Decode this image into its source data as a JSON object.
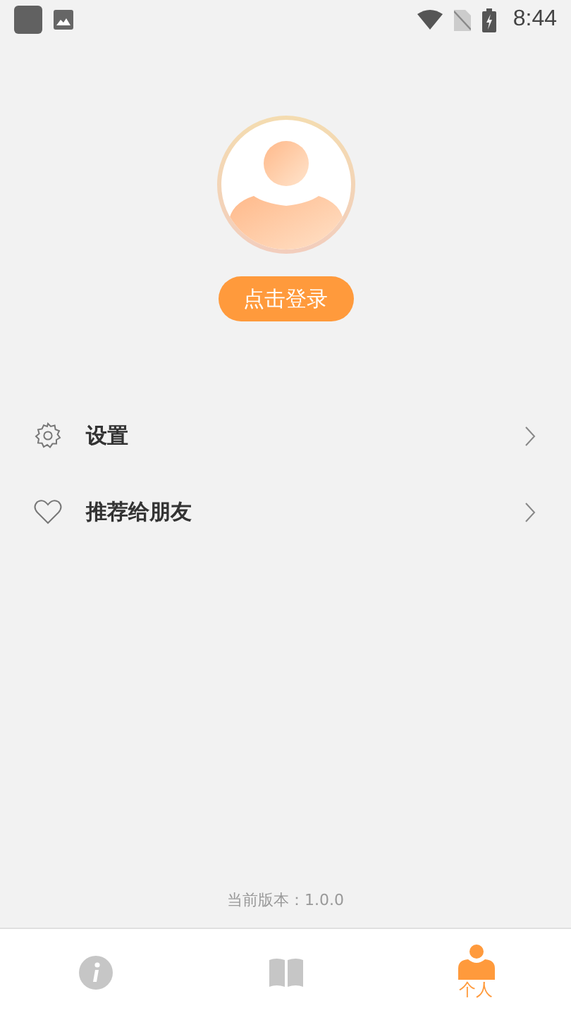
{
  "status_bar": {
    "time": "8:44"
  },
  "login_button": "点击登录",
  "menu": [
    {
      "kind": "settings",
      "label": "设置"
    },
    {
      "kind": "heart",
      "label": "推荐给朋友"
    }
  ],
  "version": "当前版本：1.0.0",
  "tabs": [
    {
      "kind": "info",
      "selected": false
    },
    {
      "kind": "book",
      "selected": false
    },
    {
      "kind": "person",
      "label": "个人",
      "selected": true
    }
  ]
}
